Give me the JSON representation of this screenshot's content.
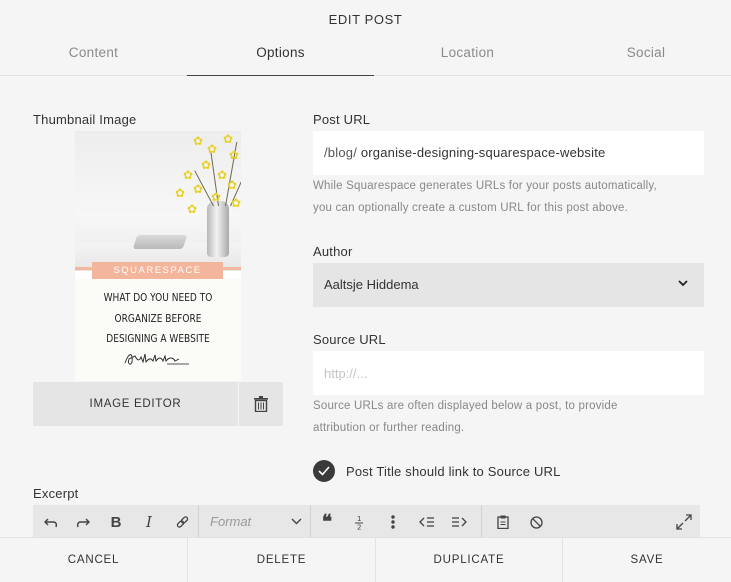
{
  "header": {
    "title": "EDIT POST",
    "tabs": [
      {
        "label": "Content"
      },
      {
        "label": "Options"
      },
      {
        "label": "Location"
      },
      {
        "label": "Social"
      }
    ],
    "active_tab": "Options"
  },
  "thumbnail": {
    "label": "Thumbnail Image",
    "banner_text": "SQUARESPACE",
    "headline_lines": [
      "WHAT DO YOU NEED TO",
      "ORGANIZE BEFORE",
      "DESIGNING A WEBSITE"
    ],
    "image_editor_label": "IMAGE EDITOR",
    "delete_icon": "trash-icon"
  },
  "post_url": {
    "label": "Post URL",
    "prefix": "/blog/",
    "value": "organise-designing-squarespace-website",
    "help_line1": "While Squarespace generates URLs for your posts automatically,",
    "help_line2": "you can optionally create a custom URL for this post above."
  },
  "author": {
    "label": "Author",
    "selected": "Aaltsje Hiddema"
  },
  "source_url": {
    "label": "Source URL",
    "placeholder": "http://...",
    "value": "",
    "help_line1": "Source URLs are often displayed below a post, to provide",
    "help_line2": "attribution or further reading."
  },
  "link_option": {
    "label": "Post Title should link to Source URL",
    "checked": true
  },
  "excerpt": {
    "label": "Excerpt",
    "format_placeholder": "Format",
    "bold_glyph": "B",
    "italic_glyph": "I"
  },
  "footer": {
    "cancel": "CANCEL",
    "delete": "DELETE",
    "duplicate": "DUPLICATE",
    "save": "SAVE"
  },
  "colors": {
    "background": "#f5f5f5",
    "field_gray": "#e5e5e5",
    "banner": "#f3b59b",
    "checkbox": "#3a3a3a"
  }
}
